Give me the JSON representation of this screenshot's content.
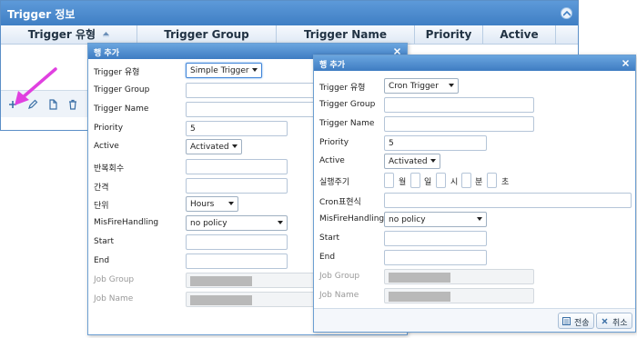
{
  "grid": {
    "title": "Trigger 정보",
    "columns": [
      "Trigger 유형",
      "Trigger Group",
      "Trigger Name",
      "Priority",
      "Active"
    ]
  },
  "dialog_left": {
    "title": "행 추가",
    "labels": {
      "type": "Trigger 유형",
      "group": "Trigger Group",
      "name": "Trigger Name",
      "priority": "Priority",
      "active": "Active",
      "repeat_count": "반복회수",
      "interval": "간격",
      "unit": "단위",
      "misfire": "MisFireHandling",
      "start": "Start",
      "end": "End",
      "job_group": "Job Group",
      "job_name": "Job Name"
    },
    "values": {
      "type": "Simple Trigger",
      "priority": "5",
      "active": "Activated",
      "unit": "Hours",
      "misfire": "no policy"
    }
  },
  "dialog_right": {
    "title": "행 추가",
    "labels": {
      "type": "Trigger 유형",
      "group": "Trigger Group",
      "name": "Trigger Name",
      "priority": "Priority",
      "active": "Active",
      "period": "실행주기",
      "cron": "Cron표현식",
      "misfire": "MisFireHandling",
      "start": "Start",
      "end": "End",
      "job_group": "Job Group",
      "job_name": "Job Name"
    },
    "values": {
      "type": "Cron Trigger",
      "priority": "5",
      "active": "Activated",
      "misfire": "no policy"
    },
    "period_units": [
      "월",
      "일",
      "시",
      "분",
      "초"
    ],
    "buttons": {
      "send": "전송",
      "cancel": "취소"
    }
  },
  "colors": {
    "header_blue": "#3f7fc4",
    "annotation_arrow": "#e040e0"
  }
}
